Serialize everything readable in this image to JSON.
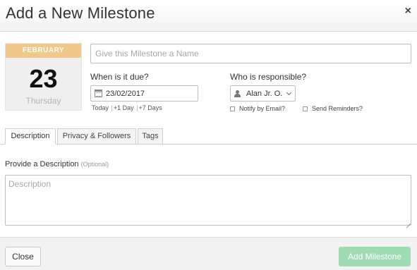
{
  "dialog": {
    "title": "Add a New Milestone",
    "close_icon": "×"
  },
  "calendar": {
    "month": "FEBRUARY",
    "day": "23",
    "weekday": "Thursday"
  },
  "name_field": {
    "placeholder": "Give this Milestone a Name",
    "value": ""
  },
  "due": {
    "label": "When is it due?",
    "date_value": "23/02/2017",
    "icon": "calendar-icon",
    "quick_links": [
      "Today",
      "+1 Day",
      "+7 Days"
    ]
  },
  "responsible": {
    "label": "Who is responsible?",
    "selected_user": "Alan Jr. O.",
    "icon": "user-icon",
    "notify_email_label": "Notify by Email?",
    "notify_email_checked": false,
    "send_reminders_label": "Send Reminders?",
    "send_reminders_checked": false
  },
  "tabs": [
    {
      "label": "Description",
      "active": true
    },
    {
      "label": "Privacy & Followers",
      "active": false
    },
    {
      "label": "Tags",
      "active": false
    }
  ],
  "description": {
    "label": "Provide a Description",
    "optional_note": "(Optional)",
    "placeholder": "Description",
    "value": ""
  },
  "footer": {
    "close_label": "Close",
    "add_label": "Add Milestone"
  },
  "colors": {
    "calendar_month_bg": "#f0c98a",
    "add_button_bg": "#9edcb4"
  }
}
